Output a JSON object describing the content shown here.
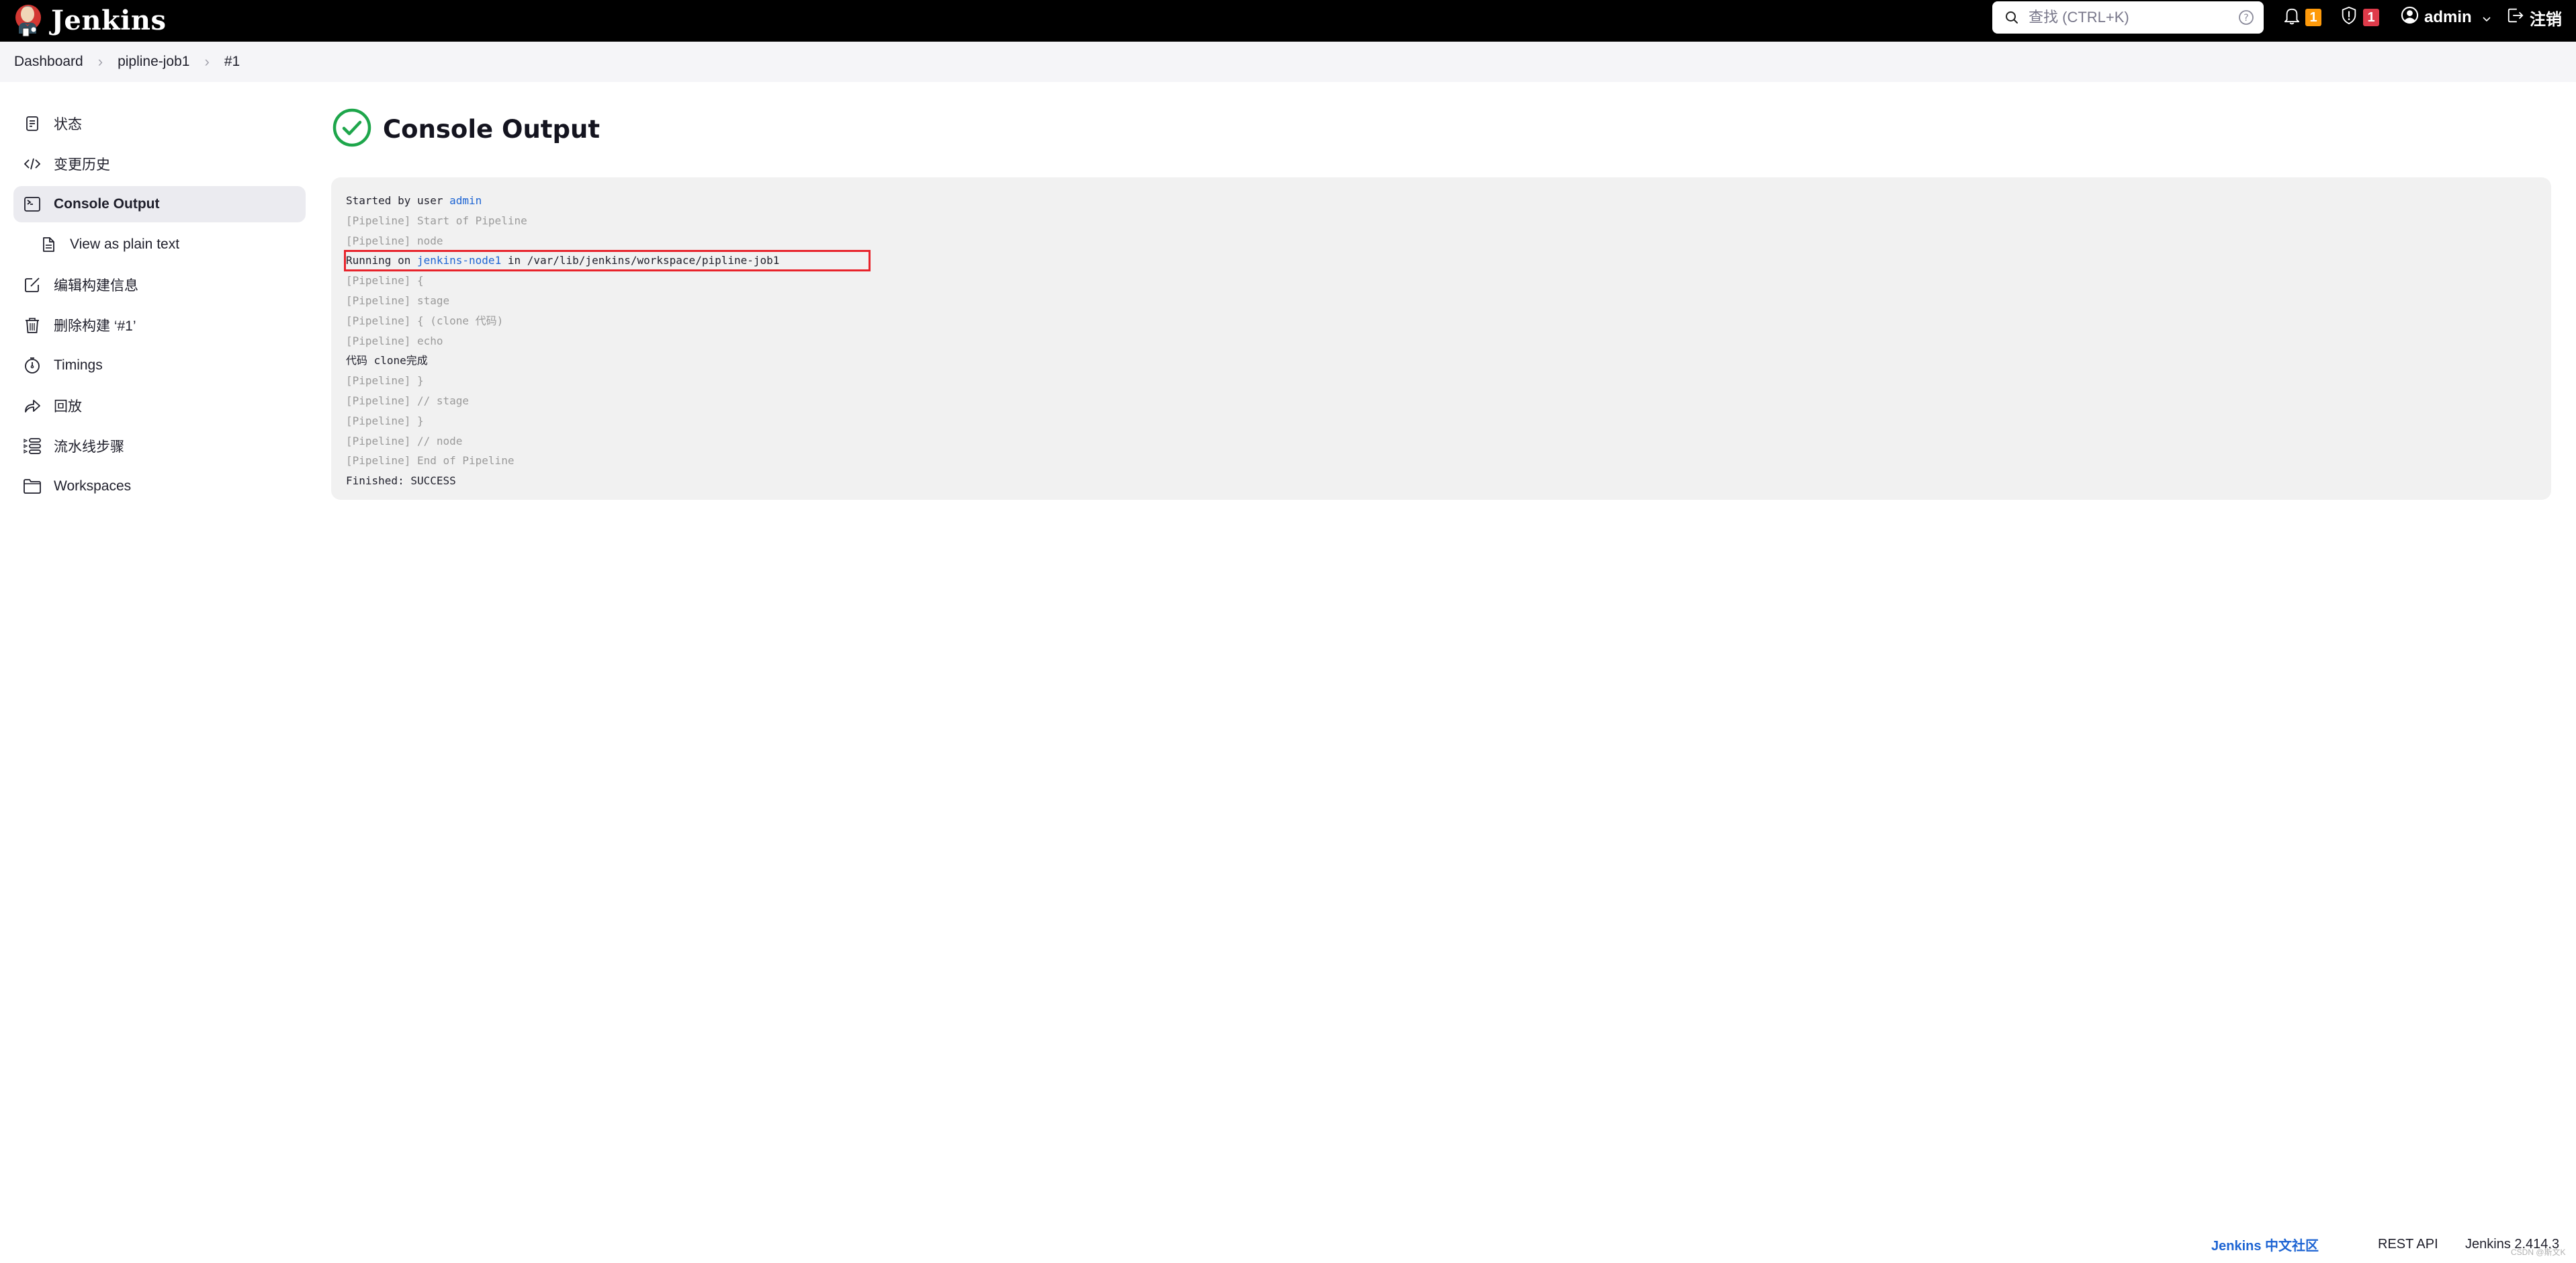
{
  "header": {
    "logo_text": "Jenkins",
    "search_placeholder": "查找 (CTRL+K)",
    "notifications_count": "1",
    "security_count": "1",
    "user_name": "admin",
    "logout_label": "注销"
  },
  "breadcrumb": [
    {
      "label": "Dashboard"
    },
    {
      "label": "pipline-job1"
    },
    {
      "label": "#1"
    }
  ],
  "breadcrumb_sep": "›",
  "sidebar": {
    "items": [
      {
        "label": "状态",
        "icon": "document-icon"
      },
      {
        "label": "变更历史",
        "icon": "code-icon"
      },
      {
        "label": "Console Output",
        "icon": "terminal-icon",
        "active": true
      },
      {
        "label": "View as plain text",
        "icon": "file-icon",
        "sub": true
      },
      {
        "label": "编辑构建信息",
        "icon": "edit-icon"
      },
      {
        "label": "删除构建 ‘#1’",
        "icon": "trash-icon"
      },
      {
        "label": "Timings",
        "icon": "stopwatch-icon"
      },
      {
        "label": "回放",
        "icon": "replay-icon"
      },
      {
        "label": "流水线步骤",
        "icon": "steps-icon"
      },
      {
        "label": "Workspaces",
        "icon": "folder-icon"
      }
    ]
  },
  "main": {
    "title": "Console Output",
    "status": "success",
    "status_color": "#1ea64b",
    "console_lines": [
      {
        "prefix": "Started by user ",
        "link": "admin",
        "suffix": "",
        "dim": false
      },
      {
        "prefix": "[Pipeline] Start of Pipeline",
        "dim": true
      },
      {
        "prefix": "[Pipeline] node",
        "dim": true
      },
      {
        "prefix": "Running on ",
        "link": "jenkins-node1",
        "suffix": " in /var/lib/jenkins/workspace/pipline-job1",
        "dim": false,
        "highlighted": true
      },
      {
        "prefix": "[Pipeline] {",
        "dim": true
      },
      {
        "prefix": "[Pipeline] stage",
        "dim": true
      },
      {
        "prefix": "[Pipeline] { (clone 代码)",
        "dim": true
      },
      {
        "prefix": "[Pipeline] echo",
        "dim": true
      },
      {
        "prefix": "代码 clone完成",
        "dim": false
      },
      {
        "prefix": "[Pipeline] }",
        "dim": true
      },
      {
        "prefix": "[Pipeline] // stage",
        "dim": true
      },
      {
        "prefix": "[Pipeline] }",
        "dim": true
      },
      {
        "prefix": "[Pipeline] // node",
        "dim": true
      },
      {
        "prefix": "[Pipeline] End of Pipeline",
        "dim": true
      },
      {
        "prefix": "Finished: SUCCESS",
        "dim": false
      }
    ]
  },
  "footer": {
    "community_link": "Jenkins 中文社区",
    "rest_api": "REST API",
    "version": "Jenkins 2.414.3",
    "watermark": "CSDN @斯文K"
  },
  "colors": {
    "link": "#1d64d3",
    "highlight_border": "#e8232b",
    "badge_orange": "#fe9a0b",
    "badge_red": "#de3b4a"
  }
}
